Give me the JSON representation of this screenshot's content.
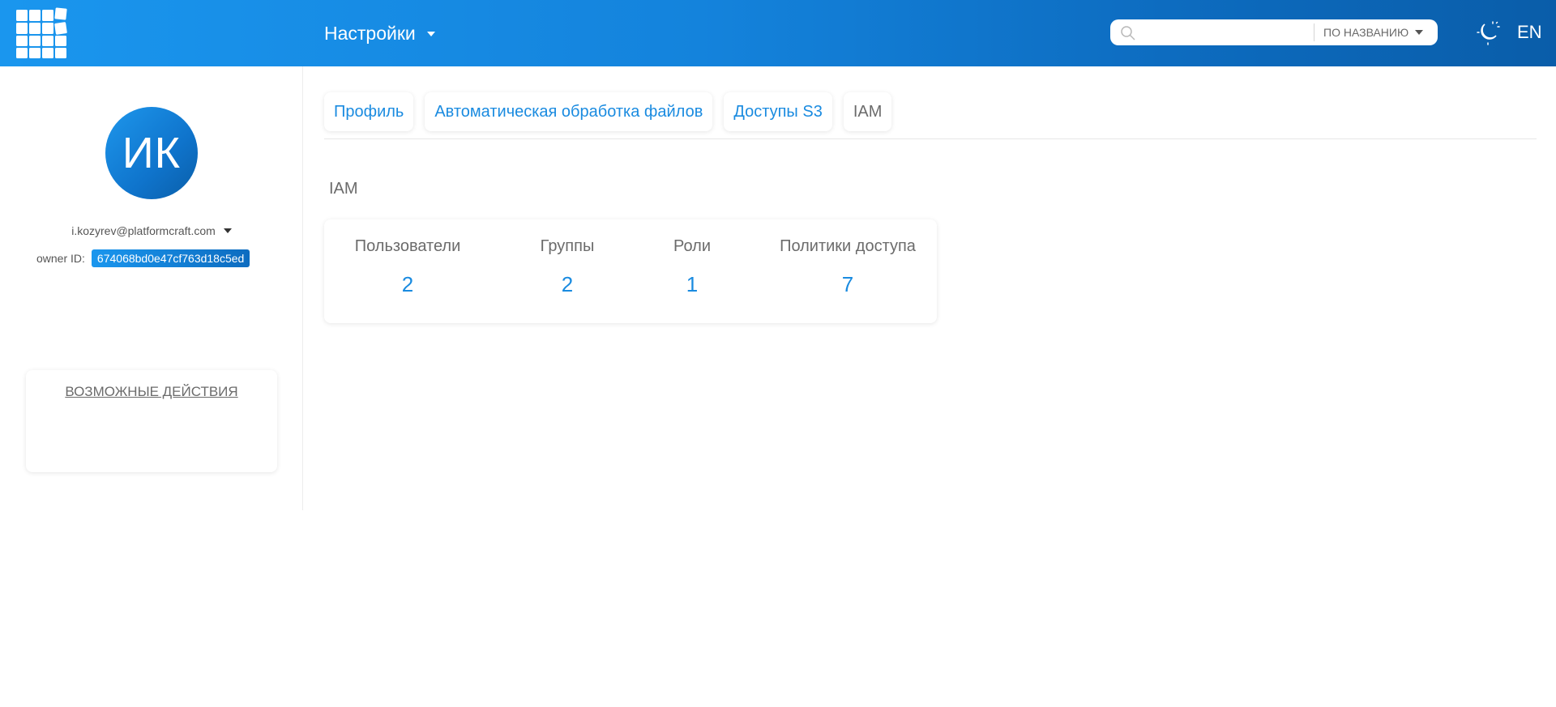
{
  "header": {
    "title": "Настройки",
    "search": {
      "placeholder": "",
      "mode": "ПО НАЗВАНИЮ"
    },
    "lang": "EN"
  },
  "sidebar": {
    "avatar_initials": "ИК",
    "email": "i.kozyrev@platformcraft.com",
    "owner_label": "owner ID:",
    "owner_id": "674068bd0e47cf763d18c5ed",
    "actions_title": "ВОЗМОЖНЫЕ ДЕЙСТВИЯ"
  },
  "tabs": [
    {
      "label": "Профиль"
    },
    {
      "label": "Автоматическая обработка файлов"
    },
    {
      "label": "Доступы S3"
    },
    {
      "label": "IAM"
    }
  ],
  "active_tab": "IAM",
  "section": {
    "title": "IAM",
    "stats": [
      {
        "label": "Пользователи",
        "value": "2"
      },
      {
        "label": "Группы",
        "value": "2"
      },
      {
        "label": "Роли",
        "value": "1"
      },
      {
        "label": "Политики доступа",
        "value": "7"
      }
    ]
  },
  "colors": {
    "accent": "#1a8be0",
    "header_start": "#1a96ee",
    "header_end": "#0a5da9"
  },
  "icons": [
    "app-grid-icon",
    "search-icon",
    "chevron-down-icon",
    "theme-moon-icon"
  ]
}
